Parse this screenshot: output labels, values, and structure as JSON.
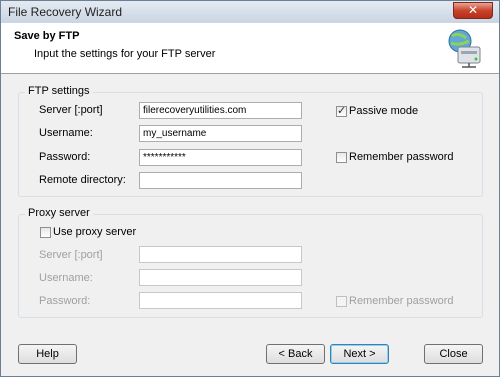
{
  "window": {
    "title": "File Recovery Wizard",
    "close_glyph": "✕"
  },
  "header": {
    "title": "Save by FTP",
    "subtitle": "Input the settings for your FTP server",
    "icon": "ftp-network-drive-icon"
  },
  "ftp": {
    "legend": "FTP settings",
    "server_label": "Server [:port]",
    "server_value": "filerecoveryutilities.com",
    "username_label": "Username:",
    "username_value": "my_username",
    "password_label": "Password:",
    "password_value": "***********",
    "remote_label": "Remote directory:",
    "remote_value": "",
    "passive_label": "Passive mode",
    "passive_checked": true,
    "remember_label": "Remember password",
    "remember_checked": false
  },
  "proxy": {
    "legend": "Proxy server",
    "use_label": "Use proxy server",
    "use_checked": false,
    "server_label": "Server [:port]",
    "server_value": "",
    "username_label": "Username:",
    "username_value": "",
    "password_label": "Password:",
    "password_value": "",
    "remember_label": "Remember password",
    "remember_checked": false
  },
  "buttons": {
    "help": "Help",
    "back": "< Back",
    "next": "Next >",
    "close": "Close"
  },
  "check_glyph": "✓"
}
